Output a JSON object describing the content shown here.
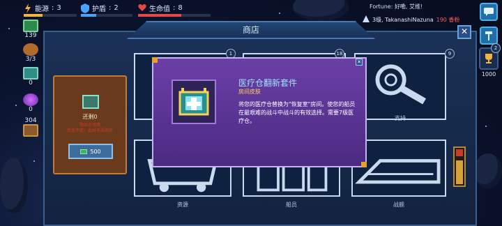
{
  "topbar": {
    "energy": {
      "label": "能源",
      "value": "3",
      "color": "#f2b43c"
    },
    "shield": {
      "label": "护盾",
      "value": "2",
      "color": "#4aa3ff"
    },
    "health": {
      "label": "生命值",
      "value": "8",
      "color": "#e84747"
    }
  },
  "news": {
    "text": "Fortune: 好嘞, 艾维!"
  },
  "rank": {
    "text": "3级, TakanashiNazuna",
    "extra": "190 香粉"
  },
  "left_resources": [
    {
      "value": "139",
      "icon": "cash-icon"
    },
    {
      "value": "3/3",
      "icon": "crew-icon"
    },
    {
      "value": "0",
      "icon": "ore-icon"
    },
    {
      "value": "0",
      "icon": "orb-icon"
    },
    {
      "value": "304",
      "icon": "crate-icon"
    }
  ],
  "right_panel": {
    "trophy_badge": "2",
    "trophy_count": "1000"
  },
  "shop": {
    "title": "商店",
    "close": "✕"
  },
  "selected_card": {
    "name": "还剩0",
    "note_line1": "购买必须用",
    "note_line2": "现金不足！此时无法购买",
    "price": "500"
  },
  "tiles": [
    {
      "key": "decor",
      "label": "",
      "badge": "1"
    },
    {
      "key": "rooms",
      "label": "",
      "badge": "18"
    },
    {
      "key": "support",
      "label": "支持",
      "badge": "9"
    },
    {
      "key": "resources",
      "label": "资源",
      "badge": ""
    },
    {
      "key": "crew",
      "label": "船员",
      "badge": ""
    },
    {
      "key": "ships",
      "label": "战舰",
      "badge": ""
    }
  ],
  "popup": {
    "title": "医疗仓翻新套件",
    "subtitle": "房间皮肤",
    "description": "将您的医疗仓替换为\"恢复室\"房间。使您的船员在最艰难的战斗中战斗的有效选择。需要7级医疗仓。",
    "close": "✕"
  },
  "colors": {
    "popup_bg": "#5a35a0",
    "card_bg": "#6a3a1c",
    "panel_bg": "#17305a"
  }
}
